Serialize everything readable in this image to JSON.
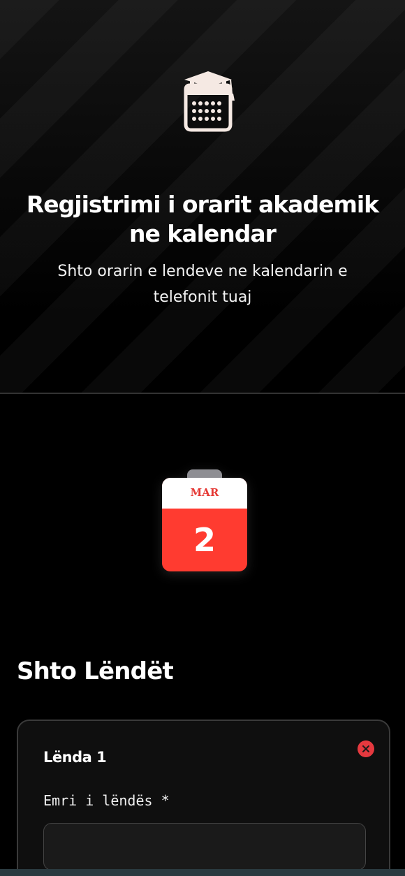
{
  "hero": {
    "icon": "calendar-graduation-cap-icon",
    "title": "Regjistrimi i orarit akademik ne kalendar",
    "subtitle": "Shto orarin e lendeve ne kalendarin e telefonit tuaj"
  },
  "calendar_widget": {
    "month": "MAR",
    "day": "2",
    "colors": {
      "accent": "#ff3b30",
      "month_text": "#e53935",
      "tab": "#8e8e93"
    }
  },
  "subjects_section": {
    "title": "Shto Lëndët",
    "cards": [
      {
        "title": "Lënda 1",
        "remove_icon": "close-icon",
        "name_field": {
          "label": "Emri i lëndës *",
          "value": "",
          "placeholder": ""
        }
      }
    ]
  }
}
